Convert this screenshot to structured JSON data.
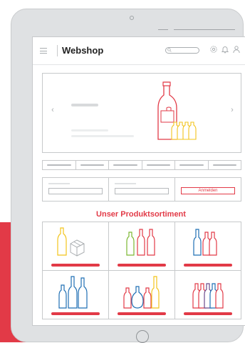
{
  "header": {
    "logo": "Webshop",
    "icons": [
      "menu-icon",
      "search-icon",
      "gear-icon",
      "bell-icon",
      "user-icon"
    ]
  },
  "hero": {
    "prev_icon": "chevron-left-icon",
    "next_icon": "chevron-right-icon"
  },
  "tabs_count": 6,
  "form": {
    "login_label": "Anmelden"
  },
  "section_title": "Unser Produktsortiment",
  "products": [
    {
      "name": "product-card-yellow-bottle-box"
    },
    {
      "name": "product-card-green-red-bottles"
    },
    {
      "name": "product-card-blue-red-bottles"
    },
    {
      "name": "product-card-blue-bottles"
    },
    {
      "name": "product-card-red-yellow-bottles"
    },
    {
      "name": "product-card-multi-bottles"
    }
  ],
  "colors": {
    "accent": "#e23a47",
    "yellow": "#f2c41b",
    "green": "#7cb833",
    "blue": "#1f6fb4",
    "red": "#e23a47",
    "purple": "#6a4a8c"
  }
}
